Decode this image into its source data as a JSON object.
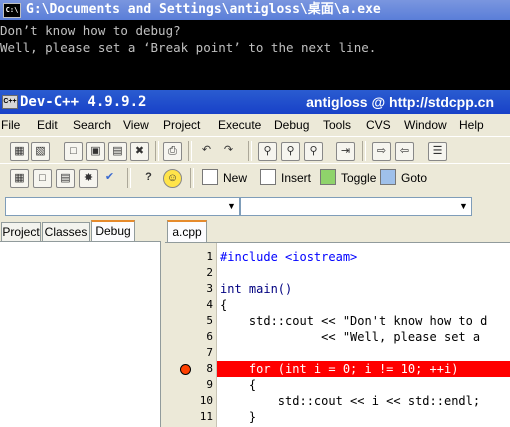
{
  "console": {
    "title": "G:\\Documents and Settings\\antigloss\\桌面\\a.exe",
    "icon_text": "C:\\",
    "lines": [
      "Don’t know how to debug?",
      "Well, please set a ‘Break point’ to the next line."
    ]
  },
  "devcpp": {
    "title": "Dev-C++ 4.9.9.2",
    "title_right": "antigloss @ http://stdcpp.cn",
    "menu": [
      "File",
      "Edit",
      "Search",
      "View",
      "Project",
      "Execute",
      "Debug",
      "Tools",
      "CVS",
      "Window",
      "Help"
    ],
    "toolbar2_buttons": {
      "new": "New",
      "insert": "Insert",
      "toggle": "Toggle",
      "goto": "Goto"
    },
    "left_tabs": [
      "Project",
      "Classes",
      "Debug"
    ],
    "editor_tab": "a.cpp",
    "line_numbers": [
      "1",
      "2",
      "3",
      "4",
      "5",
      "6",
      "7",
      "8",
      "9",
      "10",
      "11"
    ],
    "code_lines": [
      "#include <iostream>",
      "",
      "int main()",
      "{",
      "    std::cout << \"Don't know how to d",
      "              << \"Well, please set a",
      "",
      "    for (int i = 0; i != 10; ++i)",
      "    {",
      "        std::cout << i << std::endl;",
      "    }"
    ],
    "breakpoint_line": "8"
  },
  "icons": [
    "console-app-icon",
    "devcpp-app-icon",
    "breakpoint-icon",
    "dropdown-arrow-icon",
    "new-icon",
    "insert-icon",
    "toggle-icon",
    "goto-icon"
  ],
  "colors": {
    "breakpoint": "#ff0000",
    "console_bg": "#000000",
    "titlebar": "#2a5cd0",
    "tab_accent": "#e68b2c"
  }
}
